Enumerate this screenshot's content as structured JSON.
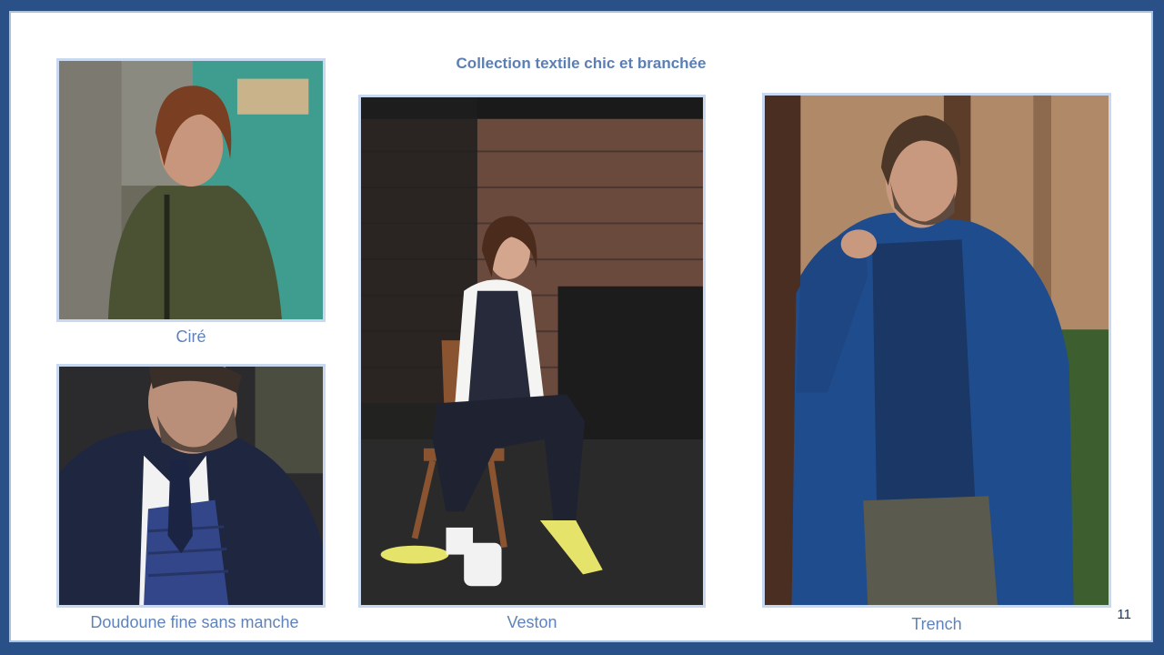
{
  "slide": {
    "title": "Collection textile chic et branchée",
    "page_number": "11",
    "items": [
      {
        "caption": "Ciré",
        "image": "woman-olive-raincoat-photo"
      },
      {
        "caption": "Doudoune fine sans manche",
        "image": "man-suit-quilted-vest-photo"
      },
      {
        "caption": "Veston",
        "image": "woman-waistcoat-chair-photo"
      },
      {
        "caption": "Trench",
        "image": "man-blue-trench-coat-photo"
      }
    ]
  },
  "colors": {
    "frame": "#2a5088",
    "title": "#5b7fb5",
    "caption": "#5f83b8",
    "photo_border": "#c8d8ee"
  }
}
